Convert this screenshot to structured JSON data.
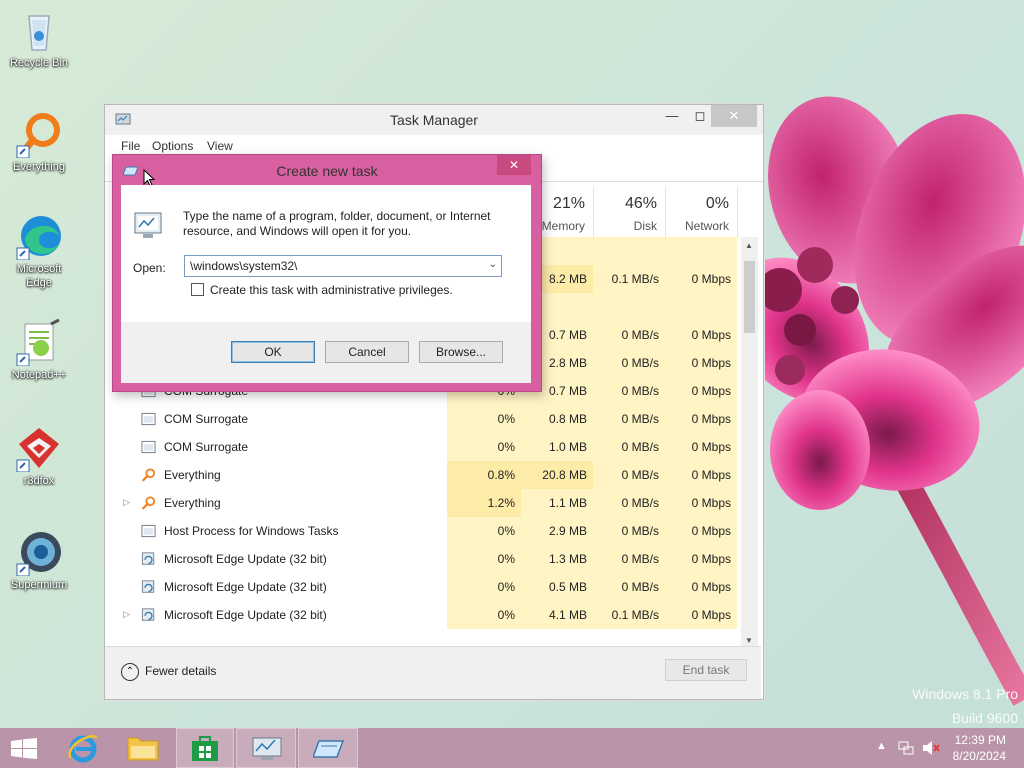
{
  "desktop": {
    "icons": [
      {
        "label": "Recycle Bin",
        "icon": "recycle-bin-icon"
      },
      {
        "label": "Everything",
        "icon": "everything-icon"
      },
      {
        "label": "Microsoft Edge",
        "icon": "edge-icon"
      },
      {
        "label": "Notepad++",
        "icon": "notepadpp-icon"
      },
      {
        "label": "r3dfox",
        "icon": "r3dfox-icon"
      },
      {
        "label": "Supermium",
        "icon": "supermium-icon"
      }
    ],
    "watermark": {
      "line1": "Windows 8.1 Pro",
      "line2": "Build 9600"
    }
  },
  "task_manager": {
    "title": "Task Manager",
    "menu": [
      "File",
      "Options",
      "View"
    ],
    "columns": [
      {
        "pct": "21%",
        "name": "Memory"
      },
      {
        "pct": "46%",
        "name": "Disk"
      },
      {
        "pct": "0%",
        "name": "Network"
      }
    ],
    "rows": [
      {
        "name": "",
        "cpu": "",
        "mem": "",
        "disk": "",
        "net": ""
      },
      {
        "name": "",
        "cpu": "",
        "mem": "8.2 MB",
        "disk": "0.1 MB/s",
        "net": "0 Mbps"
      },
      {
        "name": "",
        "cpu": "",
        "mem": "",
        "disk": "",
        "net": ""
      },
      {
        "name": "",
        "cpu": "",
        "mem": "0.7 MB",
        "disk": "0 MB/s",
        "net": "0 Mbps"
      },
      {
        "name": "",
        "cpu": "",
        "mem": "2.8 MB",
        "disk": "0 MB/s",
        "net": "0 Mbps"
      },
      {
        "name": "COM Surrogate",
        "cpu": "0%",
        "mem": "0.7 MB",
        "disk": "0 MB/s",
        "net": "0 Mbps",
        "icon": "window-icon"
      },
      {
        "name": "COM Surrogate",
        "cpu": "0%",
        "mem": "0.8 MB",
        "disk": "0 MB/s",
        "net": "0 Mbps",
        "icon": "window-icon"
      },
      {
        "name": "COM Surrogate",
        "cpu": "0%",
        "mem": "1.0 MB",
        "disk": "0 MB/s",
        "net": "0 Mbps",
        "icon": "window-icon"
      },
      {
        "name": "Everything",
        "cpu": "0.8%",
        "mem": "20.8 MB",
        "disk": "0 MB/s",
        "net": "0 Mbps",
        "icon": "everything-icon"
      },
      {
        "name": "Everything",
        "cpu": "1.2%",
        "mem": "1.1 MB",
        "disk": "0 MB/s",
        "net": "0 Mbps",
        "icon": "everything-icon",
        "expandable": true
      },
      {
        "name": "Host Process for Windows Tasks",
        "cpu": "0%",
        "mem": "2.9 MB",
        "disk": "0 MB/s",
        "net": "0 Mbps",
        "icon": "window-icon"
      },
      {
        "name": "Microsoft Edge Update (32 bit)",
        "cpu": "0%",
        "mem": "1.3 MB",
        "disk": "0 MB/s",
        "net": "0 Mbps",
        "icon": "update-icon"
      },
      {
        "name": "Microsoft Edge Update (32 bit)",
        "cpu": "0%",
        "mem": "0.5 MB",
        "disk": "0 MB/s",
        "net": "0 Mbps",
        "icon": "update-icon"
      },
      {
        "name": "Microsoft Edge Update (32 bit)",
        "cpu": "0%",
        "mem": "4.1 MB",
        "disk": "0.1 MB/s",
        "net": "0 Mbps",
        "icon": "update-icon",
        "expandable": true
      }
    ],
    "fewer_details": "Fewer details",
    "end_task": "End task"
  },
  "run_dialog": {
    "title": "Create new task",
    "description": "Type the name of a program, folder, document, or Internet resource, and Windows will open it for you.",
    "open_label": "Open:",
    "open_value": "\\windows\\system32\\",
    "admin_checkbox": "Create this task with administrative privileges.",
    "ok": "OK",
    "cancel": "Cancel",
    "browse": "Browse..."
  },
  "taskbar": {
    "time": "12:39 PM",
    "date": "8/20/2024"
  },
  "colors": {
    "dialog_frame": "#d860a0",
    "taskbar": "#ba95a9",
    "heat_light": "#fff4c4",
    "heat_mid": "#fdeba8"
  }
}
